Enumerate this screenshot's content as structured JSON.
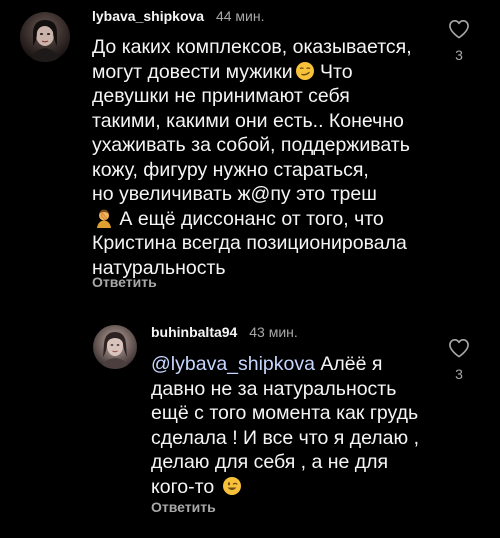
{
  "comments": [
    {
      "username": "lybava_shipkova",
      "time": "44 мин.",
      "text_part1": "До каких комплексов, оказывается,\nмогут довести мужики",
      "emoji1": "smirking-face",
      "text_part2": " Что\nдевушки не принимают себя\nтакими, какими они есть.. Конечно\nухаживать за собой, поддерживать\nкожу, фигуру нужно стараться,\nно увеличивать ж@пу это треш\n",
      "emoji2": "person-facepalming",
      "text_part3": " А ещё диссонанс от того, что\nКристина всегда позиционировала\nнатуральность",
      "reply_label": "Ответить",
      "like_count": "3"
    },
    {
      "username": "buhinbalta94",
      "time": "43 мин.",
      "mention": "@lybava_shipkova",
      "text_part1": " Алёё я\nдавно не за натуральность\nещё с того момента как грудь\nсделала ! И все что я делаю ,\nделаю для себя , а не для\nкого-то ",
      "emoji1": "winking-face",
      "reply_label": "Ответить",
      "like_count": "3"
    }
  ],
  "colors": {
    "background": "#000000",
    "text": "#f5f5f5",
    "secondary": "#a8a8a8",
    "mention": "#c6d6ff"
  }
}
